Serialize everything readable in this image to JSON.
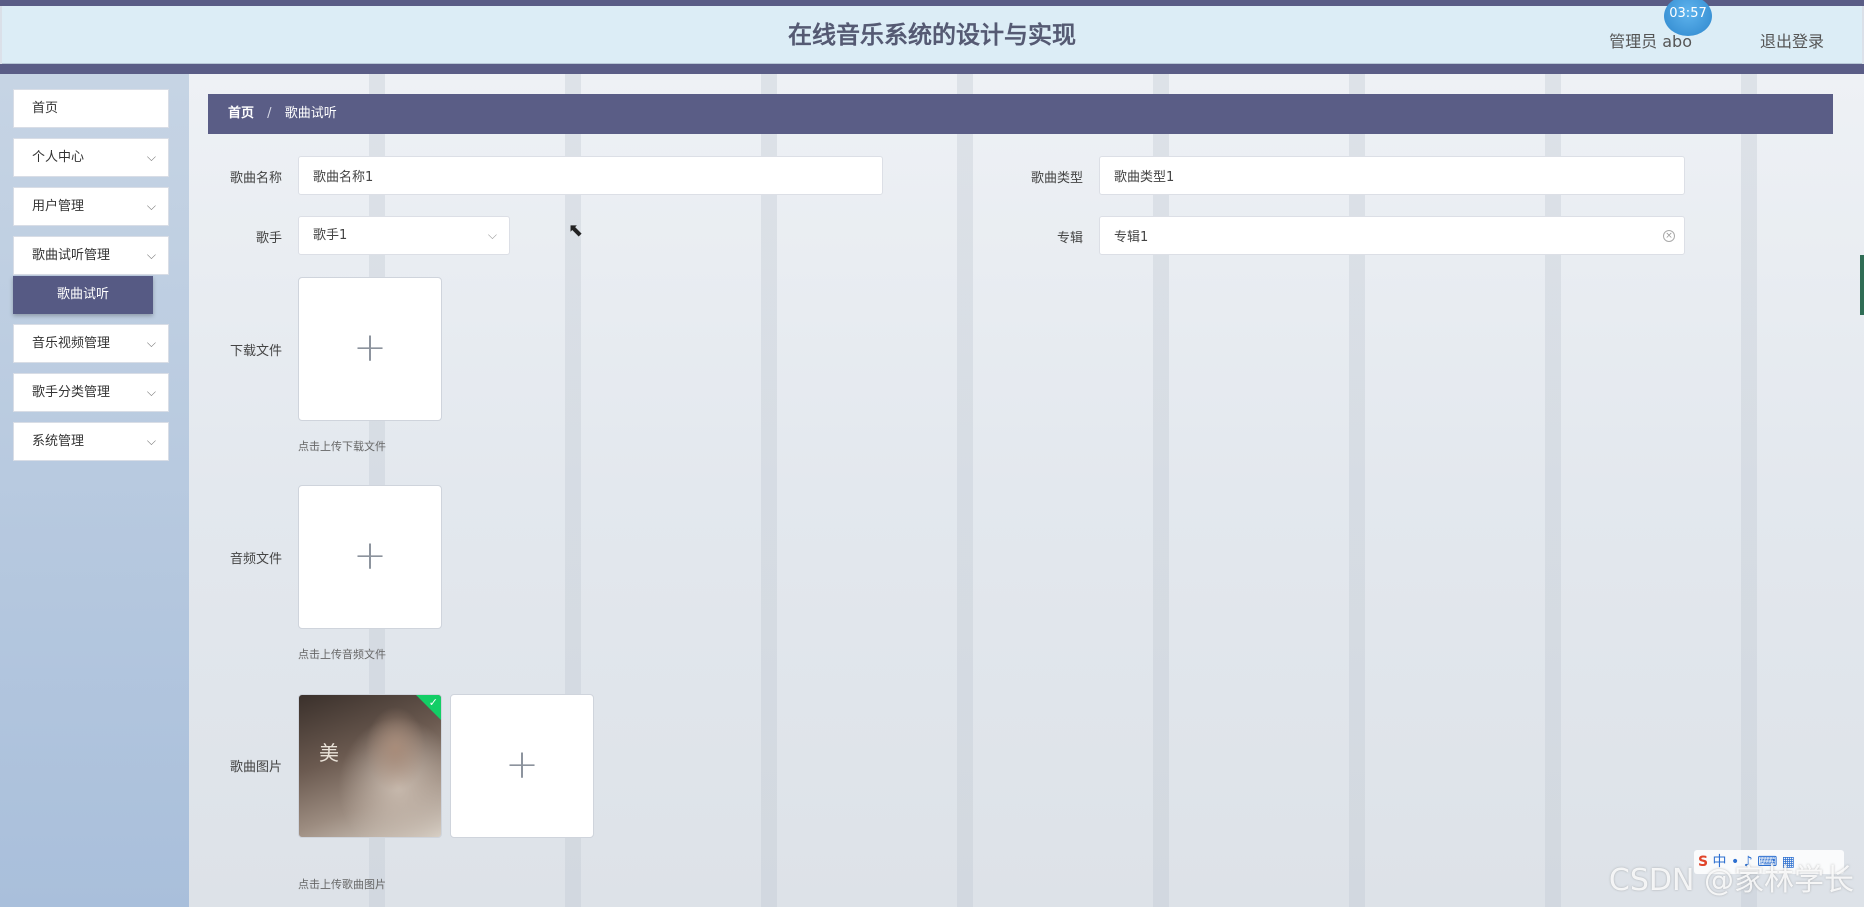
{
  "header": {
    "title": "在线音乐系统的设计与实现",
    "user": "管理员 abo",
    "logout": "退出登录",
    "clock": "03:57"
  },
  "sidebar": {
    "items": [
      {
        "label": "首页"
      },
      {
        "label": "个人中心"
      },
      {
        "label": "用户管理"
      },
      {
        "label": "歌曲试听管理"
      },
      {
        "label": "音乐视频管理"
      },
      {
        "label": "歌手分类管理"
      },
      {
        "label": "系统管理"
      }
    ],
    "active_sub": "歌曲试听"
  },
  "breadcrumb": {
    "home": "首页",
    "separator": "/",
    "current": "歌曲试听"
  },
  "form": {
    "song_name": {
      "label": "歌曲名称",
      "value": "歌曲名称1"
    },
    "song_type": {
      "label": "歌曲类型",
      "value": "歌曲类型1"
    },
    "singer": {
      "label": "歌手",
      "value": "歌手1"
    },
    "album": {
      "label": "专辑",
      "value": "专辑1"
    },
    "download_file": {
      "label": "下载文件",
      "tip": "点击上传下载文件"
    },
    "audio_file": {
      "label": "音频文件",
      "tip": "点击上传音频文件"
    },
    "song_image": {
      "label": "歌曲图片",
      "tip": "点击上传歌曲图片",
      "thumb_text": "美"
    }
  },
  "overlay": {
    "watermark": "CSDN @家林学长",
    "ime": "中 • ♪ ⌨ ▦"
  },
  "icons": {
    "plus": "+",
    "chevron": "⌵",
    "check": "✓",
    "clear": "×",
    "cursor": "⬉"
  }
}
